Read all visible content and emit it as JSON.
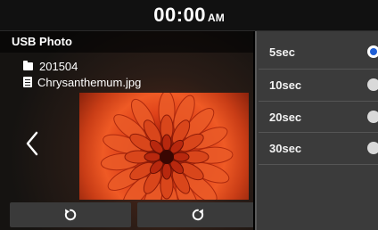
{
  "status": {
    "time": "00:00",
    "ampm": "AM"
  },
  "viewer": {
    "title": "USB Photo",
    "folder_name": "201504",
    "file_name": "Chrysanthemum.jpg",
    "icons": {
      "folder": "folder-icon",
      "file": "file-icon",
      "prev": "chevron-left-icon",
      "rotate_left": "rotate-left-icon",
      "rotate_right": "rotate-right-icon"
    }
  },
  "slideshow_options": {
    "items": [
      {
        "label": "5sec",
        "selected": true
      },
      {
        "label": "10sec",
        "selected": false
      },
      {
        "label": "20sec",
        "selected": false
      },
      {
        "label": "30sec",
        "selected": false
      }
    ]
  },
  "colors": {
    "accent": "#1f5fd6",
    "panel": "#3b3b3b",
    "button": "#3a3a3a"
  }
}
